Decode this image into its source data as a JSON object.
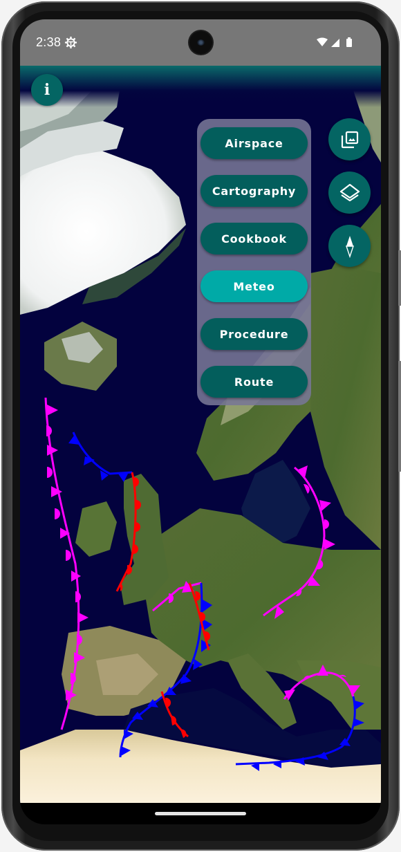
{
  "status_bar": {
    "time": "2:38",
    "icons": [
      "settings-gear-icon",
      "wifi-icon",
      "cell-signal-icon",
      "battery-icon"
    ]
  },
  "map": {
    "type": "satellite",
    "region": "North Atlantic / Europe",
    "weather_fronts": [
      {
        "type": "occluded",
        "color": "#ff00ff",
        "location": "Atlantic west of Ireland to Portugal"
      },
      {
        "type": "cold",
        "color": "#0000ff",
        "location": "Atlantic south of Iceland to Scotland"
      },
      {
        "type": "warm",
        "color": "#ff0000",
        "location": "Scotland to Cornwall"
      },
      {
        "type": "occluded",
        "color": "#ff00ff",
        "location": "central France"
      },
      {
        "type": "cold",
        "color": "#0000ff",
        "location": "France to Morocco"
      },
      {
        "type": "warm",
        "color": "#ff0000",
        "location": "Alps"
      },
      {
        "type": "warm",
        "color": "#ff0000",
        "location": "Algeria coast"
      },
      {
        "type": "occluded",
        "color": "#ff00ff",
        "location": "Baltic to Hungary"
      },
      {
        "type": "occluded",
        "color": "#ff00ff",
        "location": "Italy to Greece"
      },
      {
        "type": "cold",
        "color": "#0000ff",
        "location": "Greece to Tunisia"
      }
    ]
  },
  "buttons": {
    "info": {
      "icon": "info-icon",
      "label": "i"
    }
  },
  "layer_menu": {
    "items": [
      {
        "label": "Airspace",
        "active": false
      },
      {
        "label": "Cartography",
        "active": false
      },
      {
        "label": "Cookbook",
        "active": false
      },
      {
        "label": "Meteo",
        "active": true
      },
      {
        "label": "Procedure",
        "active": false
      },
      {
        "label": "Route",
        "active": false
      }
    ]
  },
  "fabs": [
    {
      "name": "gallery",
      "icon": "image-gallery-icon"
    },
    {
      "name": "layers",
      "icon": "layers-icon"
    },
    {
      "name": "compass",
      "icon": "compass-icon"
    }
  ],
  "colors": {
    "primary": "#046563",
    "menu_button": "#035e5c",
    "menu_button_active": "#00aaa7",
    "menu_panel": "#78769a",
    "cold_front": "#0000ff",
    "warm_front": "#ff0000",
    "occluded_front": "#ff00ff",
    "status_bar": "#777777"
  }
}
